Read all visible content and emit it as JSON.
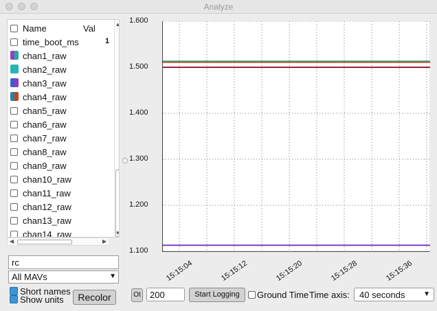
{
  "window": {
    "title": "Analyze"
  },
  "list": {
    "header": {
      "name": "Name",
      "val": "Val"
    },
    "rows": [
      {
        "label": "time_boot_ms",
        "value": "1",
        "swatch": null
      },
      {
        "label": "chan1_raw",
        "swatch": [
          "#8e44c9",
          "#2aa7a7"
        ]
      },
      {
        "label": "chan2_raw",
        "swatch": [
          "#2ab4b4",
          "#2ab4b4"
        ]
      },
      {
        "label": "chan3_raw",
        "swatch": [
          "#3a5fd0",
          "#8a3ec8"
        ]
      },
      {
        "label": "chan4_raw",
        "swatch": [
          "#2a7fa8",
          "#c0441a"
        ]
      },
      {
        "label": "chan5_raw",
        "swatch": null
      },
      {
        "label": "chan6_raw",
        "swatch": null
      },
      {
        "label": "chan7_raw",
        "swatch": null
      },
      {
        "label": "chan8_raw",
        "swatch": null
      },
      {
        "label": "chan9_raw",
        "swatch": null
      },
      {
        "label": "chan10_raw",
        "swatch": null
      },
      {
        "label": "chan11_raw",
        "swatch": null
      },
      {
        "label": "chan12_raw",
        "swatch": null
      },
      {
        "label": "chan13_raw",
        "swatch": null
      },
      {
        "label": "chan14_raw",
        "swatch": null
      }
    ]
  },
  "filter": {
    "value": "rc"
  },
  "mav_select": {
    "value": "All MAVs"
  },
  "options": {
    "short_names": "Short names",
    "show_units": "Show units"
  },
  "recolor_button": "Recolor",
  "bottom": {
    "small_button": "Ot",
    "rate_value": "200",
    "start_logging": "Start Logging",
    "ground_time": "Ground Time",
    "time_axis_label": "Time axis:",
    "time_axis_value": "40 seconds"
  },
  "chart_data": {
    "type": "line",
    "yticks": [
      "1.600",
      "1.500",
      "1.400",
      "1.300",
      "1.200",
      "1.100"
    ],
    "xticks": [
      "15:15:04",
      "15:15:12",
      "15:15:20",
      "15:15:28",
      "15:15:36"
    ],
    "ylim": [
      1.1,
      1.6
    ],
    "grid": true,
    "series": [
      {
        "color": "#7b3ec6",
        "values": [
          1.113,
          1.113,
          1.113,
          1.113,
          1.113
        ]
      },
      {
        "color": "#2aa7a7",
        "values": [
          1.513,
          1.513,
          1.513,
          1.513,
          1.513
        ]
      },
      {
        "color": "#b8531a",
        "values": [
          1.511,
          1.511,
          1.511,
          1.511,
          1.511
        ]
      },
      {
        "color": "#9c1f3c",
        "values": [
          1.5,
          1.5,
          1.5,
          1.5,
          1.5
        ]
      }
    ]
  }
}
